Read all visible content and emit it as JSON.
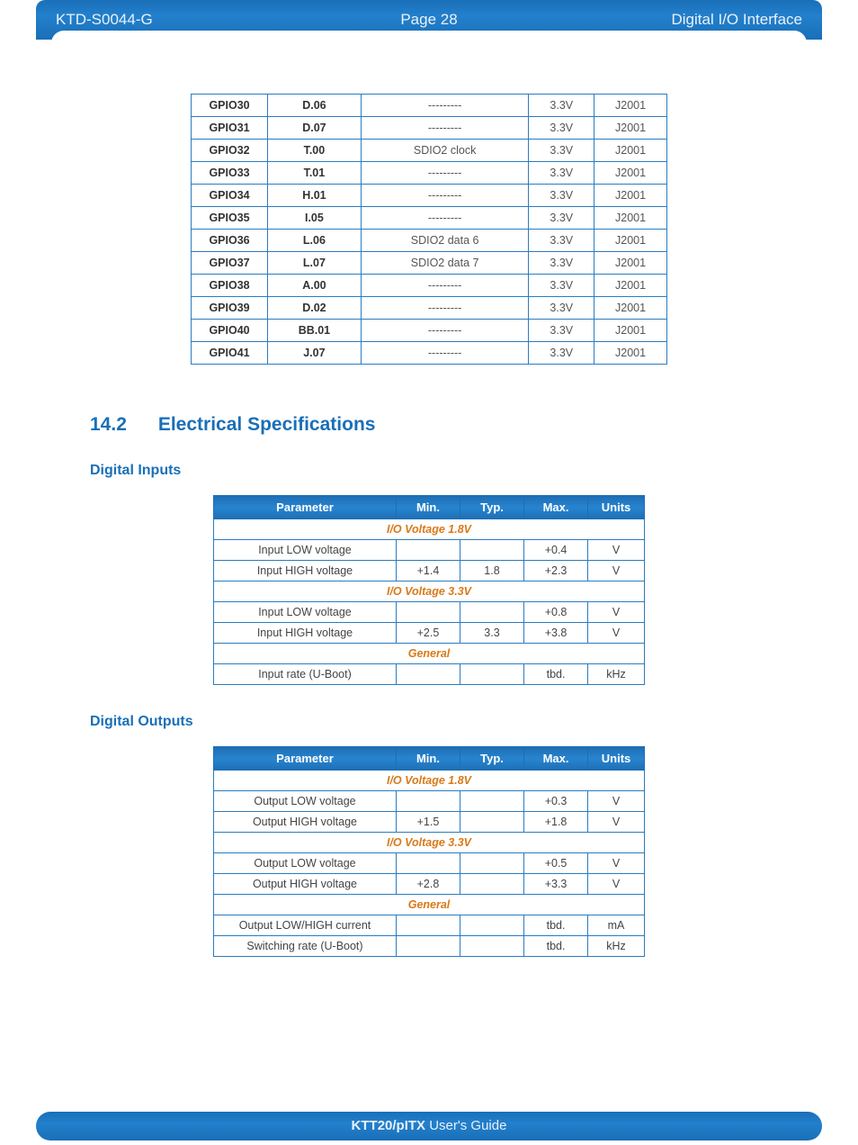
{
  "header": {
    "doc_code": "KTD-S0044-G",
    "page_label": "Page 28",
    "section_title": "Digital I/O Interface"
  },
  "gpio_rows": [
    {
      "name": "GPIO30",
      "pin": "D.06",
      "fn": "---------",
      "v": "3.3V",
      "conn": "J2001"
    },
    {
      "name": "GPIO31",
      "pin": "D.07",
      "fn": "---------",
      "v": "3.3V",
      "conn": "J2001"
    },
    {
      "name": "GPIO32",
      "pin": "T.00",
      "fn": "SDIO2 clock",
      "v": "3.3V",
      "conn": "J2001"
    },
    {
      "name": "GPIO33",
      "pin": "T.01",
      "fn": "---------",
      "v": "3.3V",
      "conn": "J2001"
    },
    {
      "name": "GPIO34",
      "pin": "H.01",
      "fn": "---------",
      "v": "3.3V",
      "conn": "J2001"
    },
    {
      "name": "GPIO35",
      "pin": "I.05",
      "fn": "---------",
      "v": "3.3V",
      "conn": "J2001"
    },
    {
      "name": "GPIO36",
      "pin": "L.06",
      "fn": "SDIO2 data 6",
      "v": "3.3V",
      "conn": "J2001"
    },
    {
      "name": "GPIO37",
      "pin": "L.07",
      "fn": "SDIO2 data 7",
      "v": "3.3V",
      "conn": "J2001"
    },
    {
      "name": "GPIO38",
      "pin": "A.00",
      "fn": "---------",
      "v": "3.3V",
      "conn": "J2001"
    },
    {
      "name": "GPIO39",
      "pin": "D.02",
      "fn": "---------",
      "v": "3.3V",
      "conn": "J2001"
    },
    {
      "name": "GPIO40",
      "pin": "BB.01",
      "fn": "---------",
      "v": "3.3V",
      "conn": "J2001"
    },
    {
      "name": "GPIO41",
      "pin": "J.07",
      "fn": "---------",
      "v": "3.3V",
      "conn": "J2001"
    }
  ],
  "section_14_2": {
    "num": "14.2",
    "title": "Electrical Specifications"
  },
  "inputs": {
    "title": "Digital Inputs",
    "headers": {
      "param": "Parameter",
      "min": "Min.",
      "typ": "Typ.",
      "max": "Max.",
      "units": "Units"
    },
    "groups": [
      {
        "label": "I/O Voltage 1.8V",
        "rows": [
          {
            "p": "Input LOW voltage",
            "min": "",
            "typ": "",
            "max": "+0.4",
            "u": "V"
          },
          {
            "p": "Input HIGH voltage",
            "min": "+1.4",
            "typ": "1.8",
            "max": "+2.3",
            "u": "V"
          }
        ]
      },
      {
        "label": "I/O Voltage 3.3V",
        "rows": [
          {
            "p": "Input LOW voltage",
            "min": "",
            "typ": "",
            "max": "+0.8",
            "u": "V"
          },
          {
            "p": "Input HIGH voltage",
            "min": "+2.5",
            "typ": "3.3",
            "max": "+3.8",
            "u": "V"
          }
        ]
      },
      {
        "label": "General",
        "rows": [
          {
            "p": "Input rate (U-Boot)",
            "min": "",
            "typ": "",
            "max": "tbd.",
            "u": "kHz"
          }
        ]
      }
    ]
  },
  "outputs": {
    "title": "Digital Outputs",
    "headers": {
      "param": "Parameter",
      "min": "Min.",
      "typ": "Typ.",
      "max": "Max.",
      "units": "Units"
    },
    "groups": [
      {
        "label": "I/O Voltage 1.8V",
        "rows": [
          {
            "p": "Output LOW voltage",
            "min": "",
            "typ": "",
            "max": "+0.3",
            "u": "V"
          },
          {
            "p": "Output HIGH voltage",
            "min": "+1.5",
            "typ": "",
            "max": "+1.8",
            "u": "V"
          }
        ]
      },
      {
        "label": "I/O Voltage 3.3V",
        "rows": [
          {
            "p": "Output LOW voltage",
            "min": "",
            "typ": "",
            "max": "+0.5",
            "u": "V"
          },
          {
            "p": "Output HIGH voltage",
            "min": "+2.8",
            "typ": "",
            "max": "+3.3",
            "u": "V"
          }
        ]
      },
      {
        "label": "General",
        "rows": [
          {
            "p": "Output LOW/HIGH current",
            "min": "",
            "typ": "",
            "max": "tbd.",
            "u": "mA"
          },
          {
            "p": "Switching rate (U-Boot)",
            "min": "",
            "typ": "",
            "max": "tbd.",
            "u": "kHz"
          }
        ]
      }
    ]
  },
  "footer": {
    "bold": "KTT20/pITX",
    "rest": " User's Guide"
  }
}
